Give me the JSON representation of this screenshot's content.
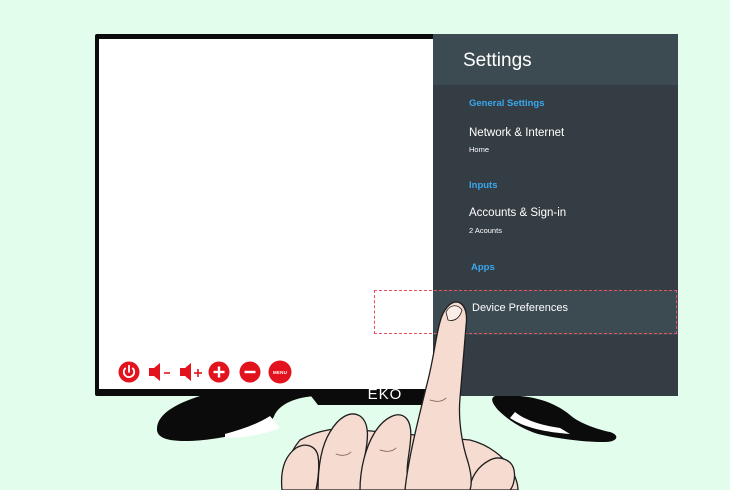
{
  "settings": {
    "title": "Settings",
    "sections": {
      "general": "General Settings",
      "inputs": "Inputs",
      "apps": "Apps"
    },
    "items": {
      "network": {
        "label": "Network & Internet",
        "sub": "Home"
      },
      "accounts": {
        "label": "Accounts & Sign-in",
        "sub": "2 Acounts"
      },
      "device_preferences": {
        "label": "Device Preferences"
      }
    }
  },
  "tv": {
    "brand": "EKO",
    "controls": [
      "power-icon",
      "volume-down-icon",
      "volume-up-icon",
      "plus-icon",
      "minus-icon",
      "menu-icon"
    ],
    "menu_label": "MENU"
  },
  "colors": {
    "background": "#e3fdec",
    "panel": "#343d44",
    "panel_header": "#3c4a52",
    "section_text": "#3aa8ee",
    "control_red": "#e3131d",
    "highlight_dash": "#e8535f"
  },
  "icons": {
    "hand": "pointing-hand-icon"
  }
}
